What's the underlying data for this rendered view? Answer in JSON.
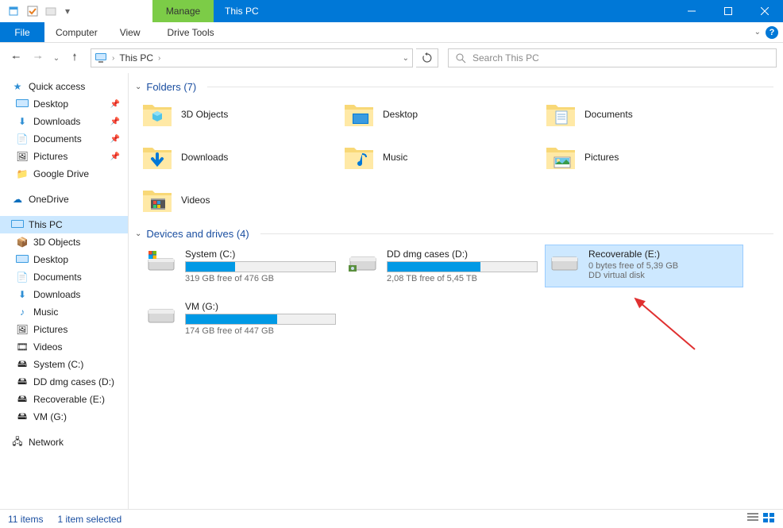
{
  "titlebar": {
    "manage_tab": "Manage",
    "title_tab": "This PC"
  },
  "ribbon": {
    "file": "File",
    "computer": "Computer",
    "view": "View",
    "drive_tools": "Drive Tools"
  },
  "address": {
    "location": "This PC",
    "chevron": "›"
  },
  "search": {
    "placeholder": "Search This PC"
  },
  "sidebar": {
    "quick_access": "Quick access",
    "qa_items": [
      {
        "label": "Desktop"
      },
      {
        "label": "Downloads"
      },
      {
        "label": "Documents"
      },
      {
        "label": "Pictures"
      },
      {
        "label": "Google Drive"
      }
    ],
    "onedrive": "OneDrive",
    "this_pc": "This PC",
    "tp_items": [
      {
        "label": "3D Objects"
      },
      {
        "label": "Desktop"
      },
      {
        "label": "Documents"
      },
      {
        "label": "Downloads"
      },
      {
        "label": "Music"
      },
      {
        "label": "Pictures"
      },
      {
        "label": "Videos"
      },
      {
        "label": "System (C:)"
      },
      {
        "label": "DD dmg cases (D:)"
      },
      {
        "label": "Recoverable (E:)"
      },
      {
        "label": "VM (G:)"
      }
    ],
    "network": "Network"
  },
  "groups": {
    "folders_header": "Folders (7)",
    "drives_header": "Devices and drives (4)"
  },
  "folders": [
    {
      "label": "3D Objects"
    },
    {
      "label": "Desktop"
    },
    {
      "label": "Documents"
    },
    {
      "label": "Downloads"
    },
    {
      "label": "Music"
    },
    {
      "label": "Pictures"
    },
    {
      "label": "Videos"
    }
  ],
  "drives": [
    {
      "name": "System (C:)",
      "free": "319 GB free of 476 GB",
      "pct": 33,
      "selected": false,
      "type": "os"
    },
    {
      "name": "DD dmg cases (D:)",
      "free": "2,08 TB free of 5,45 TB",
      "pct": 62,
      "selected": false,
      "type": "hdd"
    },
    {
      "name": "Recoverable (E:)",
      "free": "0 bytes free of 5,39 GB",
      "sub": "DD virtual disk",
      "pct": 0,
      "selected": true,
      "type": "hdd",
      "nobar": true
    },
    {
      "name": "VM (G:)",
      "free": "174 GB free of 447 GB",
      "pct": 61,
      "selected": false,
      "type": "hdd"
    }
  ],
  "status": {
    "items": "11 items",
    "selected": "1 item selected"
  }
}
